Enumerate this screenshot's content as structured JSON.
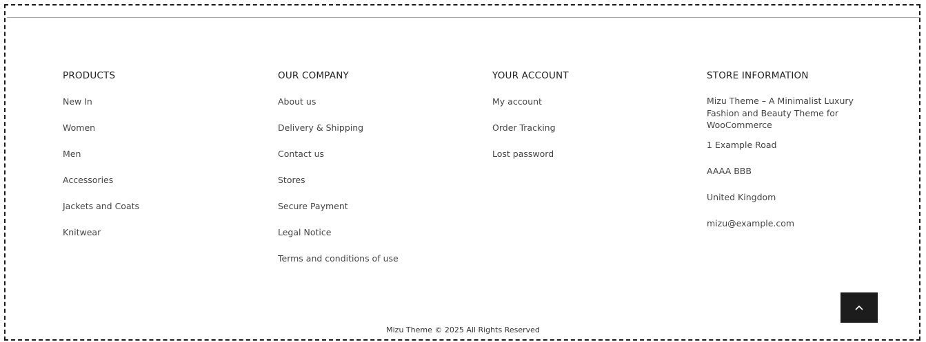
{
  "columns": {
    "products": {
      "title": "PRODUCTS",
      "links": [
        "New In",
        "Women",
        "Men",
        "Accessories",
        "Jackets and Coats",
        "Knitwear"
      ]
    },
    "company": {
      "title": "OUR COMPANY",
      "links": [
        "About us",
        "Delivery & Shipping",
        "Contact us",
        "Stores",
        "Secure Payment",
        "Legal Notice",
        "Terms and conditions of use"
      ]
    },
    "account": {
      "title": "YOUR ACCOUNT",
      "links": [
        "My account",
        "Order Tracking",
        "Lost password"
      ]
    },
    "store": {
      "title": "STORE INFORMATION",
      "description": "Mizu Theme – A Minimalist Luxury Fashion and Beauty Theme for WooCommerce",
      "address_line1": "1 Example Road",
      "address_line2": "AAAA BBB",
      "country": "United Kingdom",
      "email": "mizu@example.com"
    }
  },
  "footer": {
    "copyright": "Mizu Theme © 2025 All Rights Reserved"
  },
  "scroll_top": {
    "icon": "chevron-up-icon"
  },
  "colors": {
    "scroll_button_bg": "#1c1c1c",
    "frame_border": "#1a1a1a"
  }
}
